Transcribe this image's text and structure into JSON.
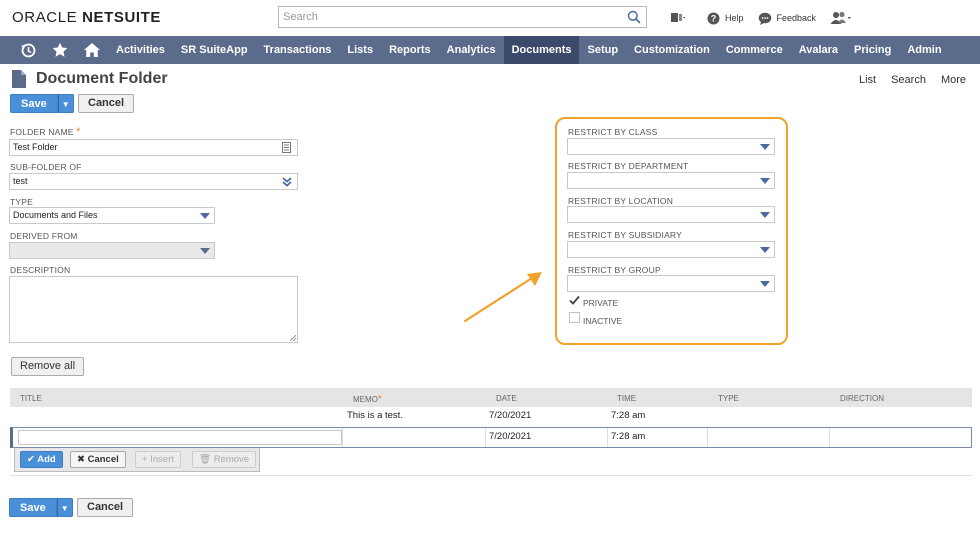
{
  "app": {
    "logo_left": "ORACLE ",
    "logo_right": "NETSUITE"
  },
  "search": {
    "placeholder": "Search"
  },
  "top_links": {
    "help": "Help",
    "feedback": "Feedback"
  },
  "nav": {
    "items": [
      "Activities",
      "SR SuiteApp",
      "Transactions",
      "Lists",
      "Reports",
      "Analytics",
      "Documents",
      "Setup",
      "Customization",
      "Commerce",
      "Avalara",
      "Pricing",
      "Admin"
    ],
    "active": "Documents"
  },
  "page": {
    "title": "Document Folder",
    "links": [
      "List",
      "Search",
      "More"
    ]
  },
  "buttons": {
    "save": "Save",
    "cancel": "Cancel",
    "remove_all": "Remove all"
  },
  "form": {
    "folder_name": {
      "label": "FOLDER NAME",
      "value": "Test Folder"
    },
    "sub_folder_of": {
      "label": "SUB-FOLDER OF",
      "value": "test"
    },
    "type": {
      "label": "TYPE",
      "value": "Documents and Files"
    },
    "derived_from": {
      "label": "DERIVED FROM",
      "value": ""
    },
    "description": {
      "label": "DESCRIPTION",
      "value": ""
    }
  },
  "restrict": {
    "class": {
      "label": "RESTRICT BY CLASS",
      "value": ""
    },
    "department": {
      "label": "RESTRICT BY DEPARTMENT",
      "value": ""
    },
    "location": {
      "label": "RESTRICT BY LOCATION",
      "value": ""
    },
    "subsidiary": {
      "label": "RESTRICT BY SUBSIDIARY",
      "value": ""
    },
    "group": {
      "label": "RESTRICT BY GROUP",
      "value": ""
    },
    "private": {
      "label": "PRIVATE",
      "checked": true
    },
    "inactive": {
      "label": "INACTIVE",
      "checked": false
    }
  },
  "table": {
    "columns": [
      "TITLE",
      "MEMO",
      "DATE",
      "TIME",
      "TYPE",
      "DIRECTION"
    ],
    "rows": [
      {
        "title": "",
        "memo": "This is a test.",
        "date": "7/20/2021",
        "time": "7:28 am",
        "type": "",
        "direction": ""
      }
    ],
    "edit_row": {
      "date": "7/20/2021",
      "time": "7:28 am"
    },
    "row_actions": {
      "add": "Add",
      "cancel": "Cancel",
      "insert": "Insert",
      "remove": "Remove"
    }
  },
  "colors": {
    "nav_bg": "#5a6b8c",
    "nav_active": "#3b4a6b",
    "primary_button": "#4a90d9",
    "highlight_box": "#f0a22a"
  }
}
